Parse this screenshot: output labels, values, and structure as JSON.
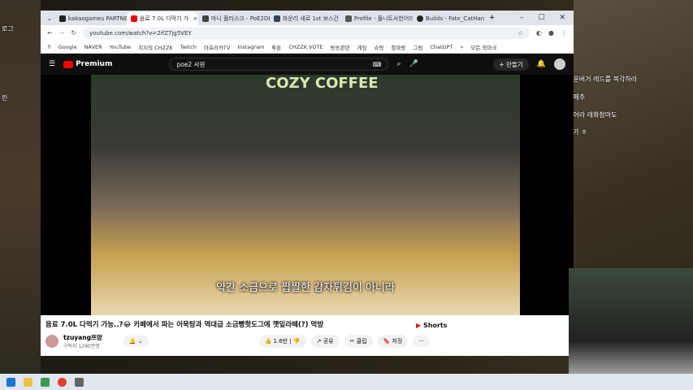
{
  "game": {
    "left_labels": [
      "로그",
      "린"
    ],
    "chat": [
      "행운버거 레드를 복각하라",
      "점메추",
      "올어라 레화참마도",
      "안가 ㅎ"
    ]
  },
  "browser": {
    "tabs": [
      {
        "label": "kakaogames PARTNERS",
        "color": "#222"
      },
      {
        "label": "음료 7.0L 다먹기 가·",
        "color": "#e00",
        "active": true
      },
      {
        "label": "마니 플라스크 - PoE2DB",
        "color": "#444"
      },
      {
        "label": "화운리 새로 1st 보스간",
        "color": "#345"
      },
      {
        "label": "Profile - 플니트사한어드",
        "color": "#555"
      },
      {
        "label": "Builds - Fate_CatHand",
        "color": "#222"
      }
    ],
    "new_tab": "+",
    "controls": [
      "–",
      "☐",
      "✕"
    ],
    "url": "youtube.com/watch?v=2ifZ7jg5VEY",
    "bookmarks": [
      "Google",
      "NAVER",
      "YouTube",
      "치지직 CHZZK",
      "Twitch",
      "아프리카TV",
      "Instagram",
      "투툰",
      "CHZZK VOTE",
      "방송관련",
      "게임",
      "쇼핑",
      "참마방",
      "그림",
      "ChatGPT",
      "»",
      "모든 북마크"
    ]
  },
  "youtube": {
    "logo": "Premium",
    "search_value": "poe2 사원",
    "create_label": "만들기",
    "subtitle": "약간 소금으로 짭짤한 감자튀김이 아니라",
    "video_sign": "COZY COFFEE",
    "title": "음료 7.0L 다먹기 가능..?😂 카페에서 파는 어묵탕과 역대급 소금빵핫도그에 깻잎라떼(?) 먹방",
    "channel": "tzuyang쯔양",
    "subscribers": "구독자 1290만명",
    "likes": "1.6만",
    "share": "공유",
    "clip": "클립",
    "save": "저장",
    "more": "···",
    "shorts": "Shorts"
  }
}
